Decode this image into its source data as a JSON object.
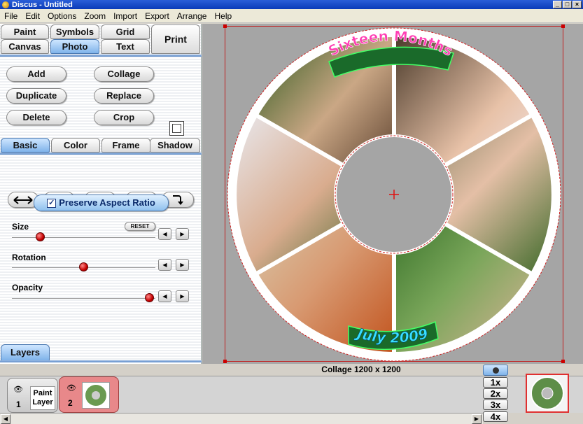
{
  "window": {
    "title": "Discus - Untitled"
  },
  "menu": [
    "File",
    "Edit",
    "Options",
    "Zoom",
    "Import",
    "Export",
    "Arrange",
    "Help"
  ],
  "tabs": {
    "paint": "Paint",
    "symbols": "Symbols",
    "grid": "Grid",
    "print": "Print",
    "canvas": "Canvas",
    "photo": "Photo",
    "text": "Text"
  },
  "photo_buttons": {
    "add": "Add",
    "collage": "Collage",
    "duplicate": "Duplicate",
    "replace": "Replace",
    "delete": "Delete",
    "crop": "Crop"
  },
  "subtabs": {
    "basic": "Basic",
    "color": "Color",
    "frame": "Frame",
    "shadow": "Shadow"
  },
  "preserve_aspect": "Preserve Aspect Ratio",
  "sliders": {
    "size": {
      "label": "Size",
      "value": 0.2
    },
    "rotation": {
      "label": "Rotation",
      "value": 0.5
    },
    "opacity": {
      "label": "Opacity",
      "value": 0.96
    }
  },
  "reset_label": "RESET",
  "layers_tab": "Layers",
  "status": "Collage  1200 x 1200",
  "disc": {
    "top_text": "Sixteen Months",
    "bottom_text": "July 2009"
  },
  "layers": [
    {
      "number": "1",
      "name_line1": "Paint",
      "name_line2": "Layer"
    },
    {
      "number": "2"
    }
  ],
  "zoom_levels": [
    "1x",
    "2x",
    "3x",
    "4x"
  ],
  "colors": {
    "selected_tab": "#7fb3ea",
    "accent_text": "#ff3fb4",
    "accent_text2": "#38e0ff",
    "layer_active": "#e8888a"
  }
}
